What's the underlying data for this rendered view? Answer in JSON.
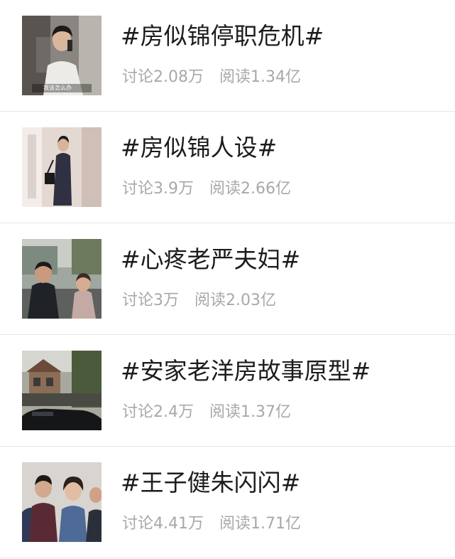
{
  "topics": [
    {
      "title": "#房似锦停职危机#",
      "discuss": "讨论2.08万",
      "read": "阅读1.34亿",
      "thumbnail_caption": "我该怎么办",
      "thumbnail_icon": "woman-on-phone-photo"
    },
    {
      "title": "#房似锦人设#",
      "discuss": "讨论3.9万",
      "read": "阅读2.66亿",
      "thumbnail_icon": "woman-in-suit-photo"
    },
    {
      "title": "#心疼老严夫妇#",
      "discuss": "讨论3万",
      "read": "阅读2.03亿",
      "thumbnail_icon": "couple-on-street-photo"
    },
    {
      "title": "#安家老洋房故事原型#",
      "discuss": "讨论2.4万",
      "read": "阅读1.37亿",
      "thumbnail_icon": "old-house-photo"
    },
    {
      "title": "#王子健朱闪闪#",
      "discuss": "讨论4.41万",
      "read": "阅读1.71亿",
      "thumbnail_icon": "group-in-uniform-photo"
    }
  ]
}
